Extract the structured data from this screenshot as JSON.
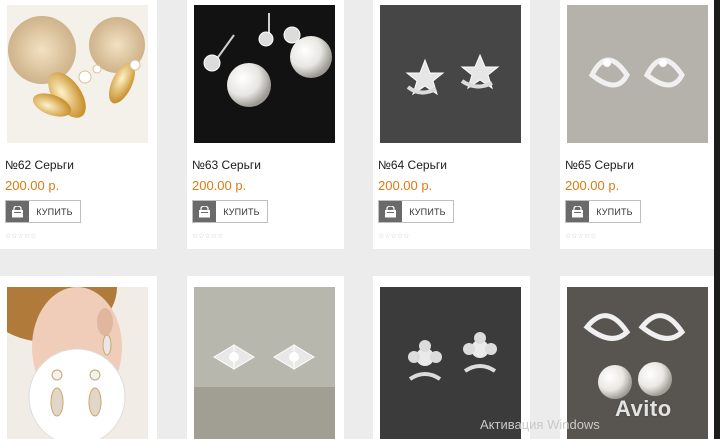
{
  "buy_label": "КУПИТЬ",
  "rating_stars": "☆☆☆☆☆",
  "products": [
    {
      "title": "№62 Серьги",
      "price": "200.00 р."
    },
    {
      "title": "№63 Серьги",
      "price": "200.00 р."
    },
    {
      "title": "№64 Серьги",
      "price": "200.00 р."
    },
    {
      "title": "№65 Серьги",
      "price": "200.00 р."
    }
  ],
  "overlay": {
    "windows_activation": "Активация Windows",
    "avito_logo": "Avito"
  },
  "colors": {
    "price": "#e07a10",
    "page_background": "#ececec",
    "cart_icon_bg": "#6a6a6a"
  }
}
